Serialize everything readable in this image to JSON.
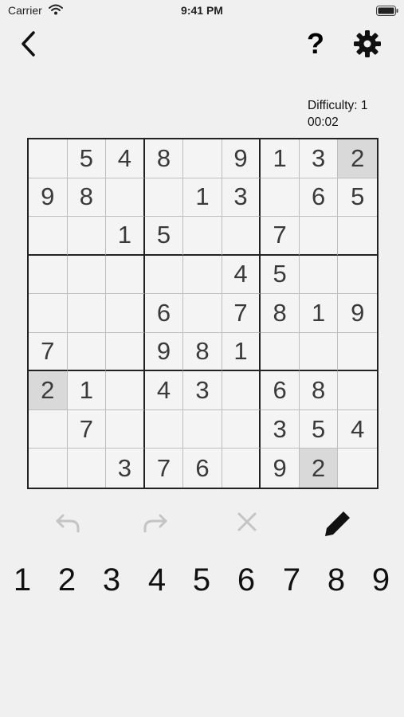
{
  "status_bar": {
    "carrier": "Carrier",
    "time": "9:41 PM"
  },
  "nav": {
    "help_label": "?"
  },
  "info": {
    "difficulty": "Difficulty: 1",
    "timer": "00:02"
  },
  "board": {
    "rows": [
      [
        "",
        "5",
        "4",
        "8",
        "",
        "9",
        "1",
        "3",
        "2"
      ],
      [
        "9",
        "8",
        "",
        "",
        "1",
        "3",
        "",
        "6",
        "5"
      ],
      [
        "",
        "",
        "1",
        "5",
        "",
        "",
        "7",
        "",
        ""
      ],
      [
        "",
        "",
        "",
        "",
        "",
        "4",
        "5",
        "",
        ""
      ],
      [
        "",
        "",
        "",
        "6",
        "",
        "7",
        "8",
        "1",
        "9"
      ],
      [
        "7",
        "",
        "",
        "9",
        "8",
        "1",
        "",
        "",
        ""
      ],
      [
        "2",
        "1",
        "",
        "4",
        "3",
        "",
        "6",
        "8",
        ""
      ],
      [
        "",
        "7",
        "",
        "",
        "",
        "",
        "3",
        "5",
        "4"
      ],
      [
        "",
        "",
        "3",
        "7",
        "6",
        "",
        "9",
        "2",
        ""
      ]
    ],
    "highlighted_cells": [
      [
        0,
        8
      ],
      [
        6,
        0
      ],
      [
        8,
        7
      ]
    ]
  },
  "toolbar": {
    "undo_icon": "undo-icon",
    "redo_icon": "redo-icon",
    "erase_icon": "erase-icon",
    "pencil_icon": "pencil-icon",
    "disabled_color": "#c4c4c4"
  },
  "numpad": [
    "1",
    "2",
    "3",
    "4",
    "5",
    "6",
    "7",
    "8",
    "9"
  ]
}
